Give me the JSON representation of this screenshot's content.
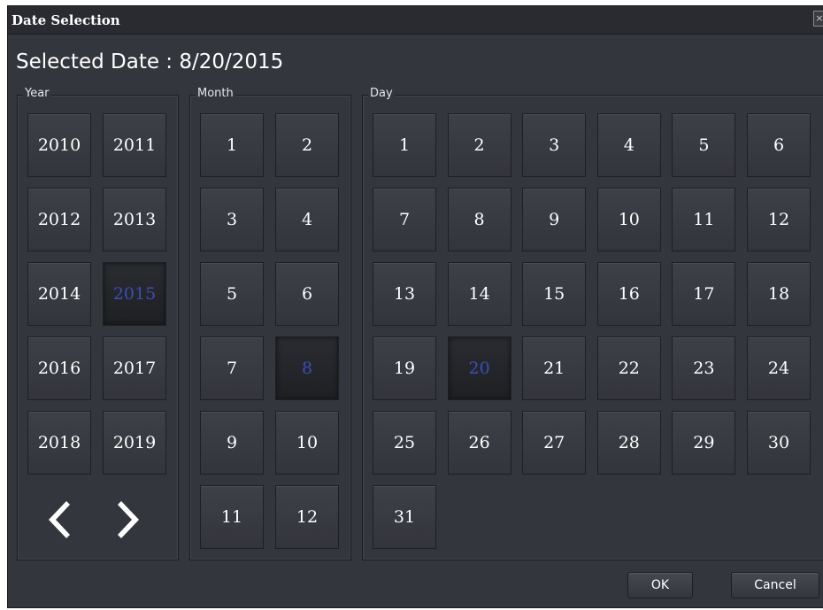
{
  "window": {
    "title": "Date Selection",
    "close_label": "×"
  },
  "selected": {
    "label": "Selected Date : ",
    "value": "8/20/2015"
  },
  "year": {
    "legend": "Year",
    "items": [
      "2010",
      "2011",
      "2012",
      "2013",
      "2014",
      "2015",
      "2016",
      "2017",
      "2018",
      "2019"
    ],
    "selected": "2015"
  },
  "month": {
    "legend": "Month",
    "items": [
      "1",
      "2",
      "3",
      "4",
      "5",
      "6",
      "7",
      "8",
      "9",
      "10",
      "11",
      "12"
    ],
    "selected": "8"
  },
  "day": {
    "legend": "Day",
    "items": [
      "1",
      "2",
      "3",
      "4",
      "5",
      "6",
      "7",
      "8",
      "9",
      "10",
      "11",
      "12",
      "13",
      "14",
      "15",
      "16",
      "17",
      "18",
      "19",
      "20",
      "21",
      "22",
      "23",
      "24",
      "25",
      "26",
      "27",
      "28",
      "29",
      "30",
      "31"
    ],
    "selected": "20"
  },
  "buttons": {
    "ok": "OK",
    "cancel": "Cancel"
  },
  "colors": {
    "selected_text": "#3a4fb8",
    "panel": "#34363d",
    "tile": "#3a3d44"
  }
}
